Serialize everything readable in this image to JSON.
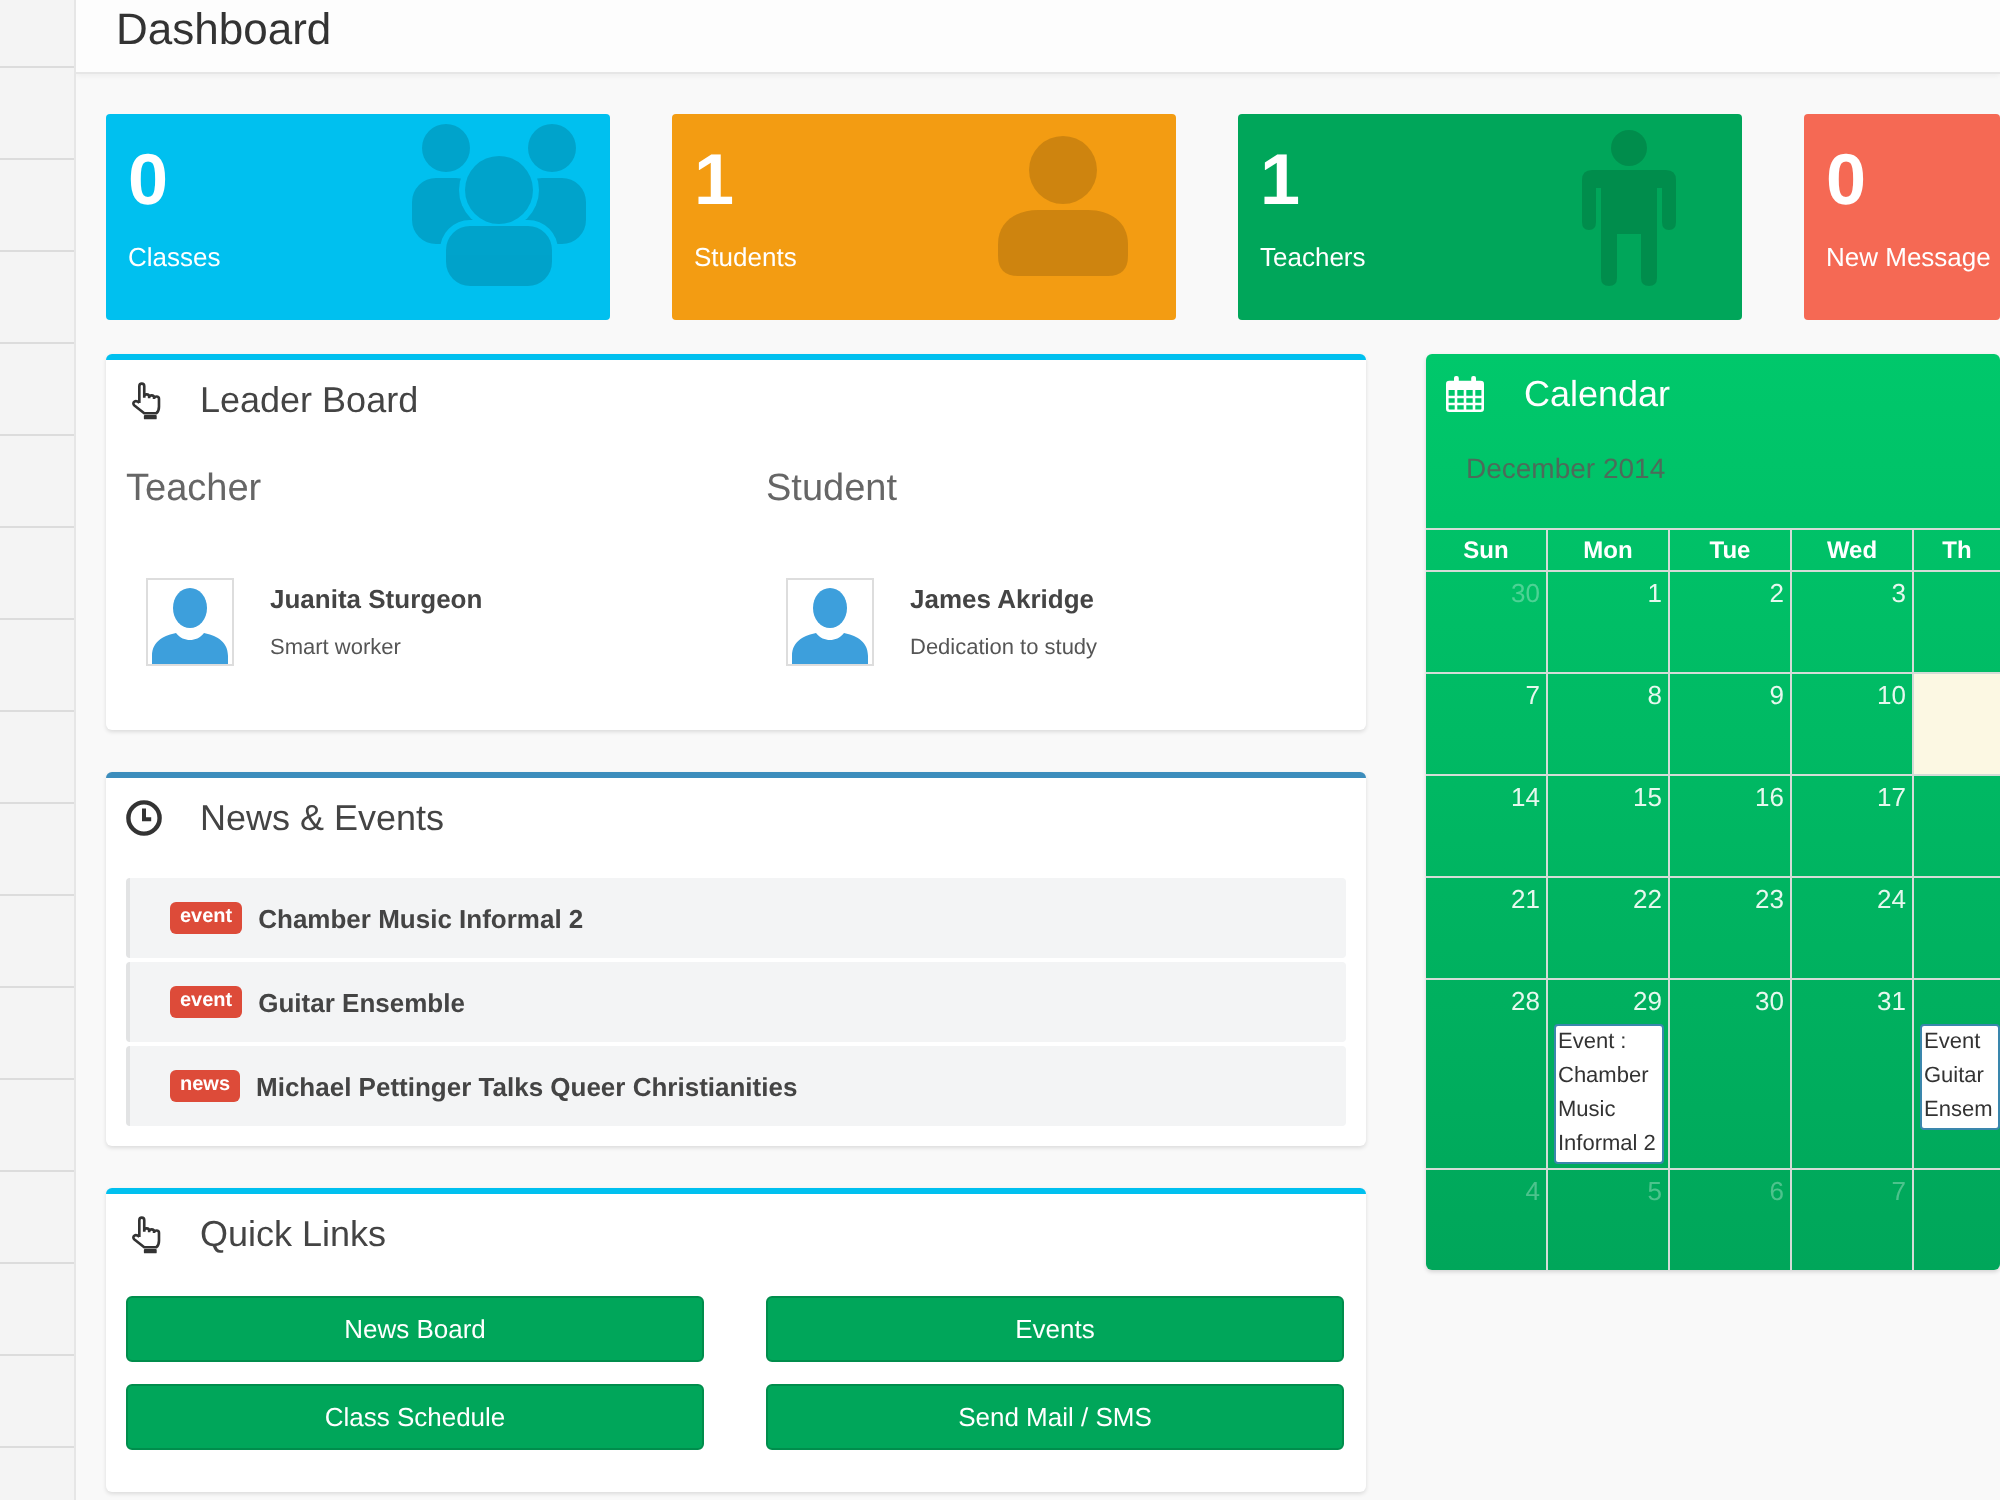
{
  "header": {
    "title": "Dashboard"
  },
  "stats": [
    {
      "value": "0",
      "label": "Classes",
      "color": "#00c0ef",
      "kind": "group"
    },
    {
      "value": "1",
      "label": "Students",
      "color": "#f39c12",
      "kind": "person"
    },
    {
      "value": "1",
      "label": "Teachers",
      "color": "#00a65a",
      "kind": "standing"
    },
    {
      "value": "0",
      "label": "New Message",
      "color": "#f56954"
    }
  ],
  "leader_board": {
    "title": "Leader Board",
    "columns": [
      {
        "heading": "Teacher",
        "name": "Juanita Sturgeon",
        "note": "Smart worker"
      },
      {
        "heading": "Student",
        "name": "James Akridge",
        "note": "Dedication to study"
      }
    ]
  },
  "news_events": {
    "title": "News & Events",
    "items": [
      {
        "tag": "event",
        "text": "Chamber Music Informal 2"
      },
      {
        "tag": "event",
        "text": "Guitar Ensemble"
      },
      {
        "tag": "news",
        "text": "Michael Pettinger Talks Queer Christianities"
      }
    ]
  },
  "quick_links": {
    "title": "Quick Links",
    "buttons": [
      "News Board",
      "Events",
      "Class Schedule",
      "Send Mail / SMS"
    ]
  },
  "calendar": {
    "title": "Calendar",
    "month": "December 2014",
    "weekdays": [
      "Sun",
      "Mon",
      "Tue",
      "Wed",
      "Th"
    ],
    "weeks": [
      [
        {
          "day": "30",
          "other_month": true,
          "today": false
        },
        {
          "day": "1",
          "other_month": false,
          "today": false
        },
        {
          "day": "2",
          "other_month": false,
          "today": false
        },
        {
          "day": "3",
          "other_month": false,
          "today": false
        },
        {
          "today": false
        }
      ],
      [
        {
          "day": "7",
          "other_month": false,
          "today": false
        },
        {
          "day": "8",
          "other_month": false,
          "today": false
        },
        {
          "day": "9",
          "other_month": false,
          "today": false
        },
        {
          "day": "10",
          "other_month": false,
          "today": false
        },
        {
          "today": true
        }
      ],
      [
        {
          "day": "14",
          "other_month": false,
          "today": false
        },
        {
          "day": "15",
          "other_month": false,
          "today": false
        },
        {
          "day": "16",
          "other_month": false,
          "today": false
        },
        {
          "day": "17",
          "other_month": false,
          "today": false
        },
        {
          "today": false
        }
      ],
      [
        {
          "day": "21",
          "other_month": false,
          "today": false
        },
        {
          "day": "22",
          "other_month": false,
          "today": false
        },
        {
          "day": "23",
          "other_month": false,
          "today": false
        },
        {
          "day": "24",
          "other_month": false,
          "today": false
        },
        {
          "today": false
        }
      ],
      [
        {
          "day": "28",
          "other_month": false,
          "today": false
        },
        {
          "day": "29",
          "other_month": false,
          "today": false,
          "event": "Event : Chamber Music Informal 2"
        },
        {
          "day": "30",
          "other_month": false,
          "today": false
        },
        {
          "day": "31",
          "other_month": false,
          "today": false
        },
        {
          "today": false,
          "event": "Event Guitar Ensem"
        }
      ],
      [
        {
          "day": "4",
          "other_month": true,
          "today": false
        },
        {
          "day": "5",
          "other_month": true,
          "today": false
        },
        {
          "day": "6",
          "other_month": true,
          "today": false
        },
        {
          "day": "7",
          "other_month": true,
          "today": false
        },
        {
          "today": false
        }
      ]
    ]
  }
}
